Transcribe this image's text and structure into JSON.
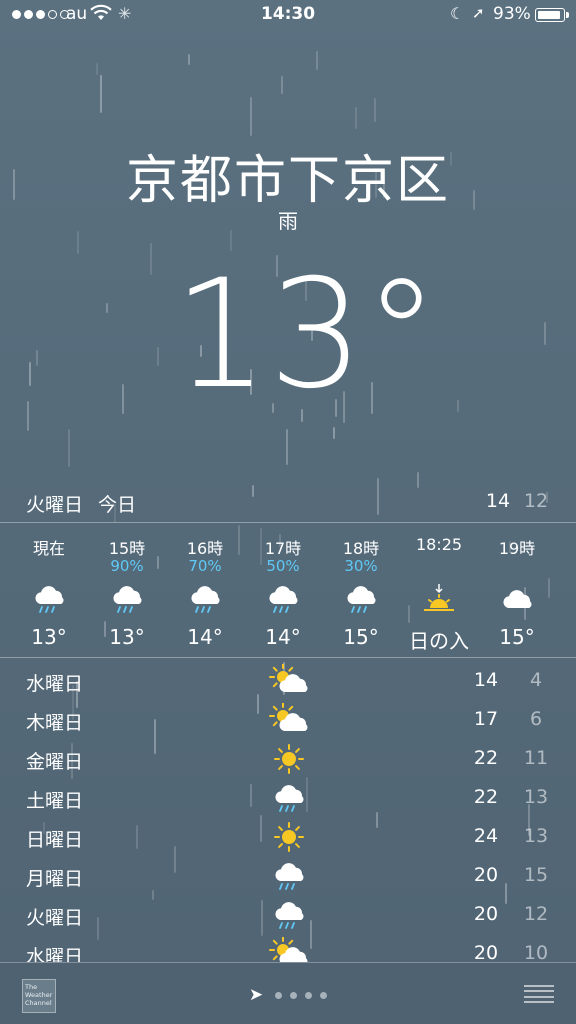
{
  "status": {
    "carrier": "au",
    "time": "14:30",
    "battery": "93%",
    "signal_bars": 3,
    "signal_total": 5,
    "battery_level": 0.93
  },
  "location": {
    "city": "京都市下京区",
    "condition": "雨",
    "temperature": "13°"
  },
  "today": {
    "day": "火曜日",
    "label": "今日",
    "high": "14",
    "low": "12"
  },
  "hourly": [
    {
      "time": "現在",
      "pop": "",
      "icon": "rain-cloud-icon",
      "temp": "13°"
    },
    {
      "time": "15時",
      "pop": "90%",
      "icon": "rain-cloud-icon",
      "temp": "13°"
    },
    {
      "time": "16時",
      "pop": "70%",
      "icon": "rain-cloud-icon",
      "temp": "14°"
    },
    {
      "time": "17時",
      "pop": "50%",
      "icon": "rain-cloud-icon",
      "temp": "14°"
    },
    {
      "time": "18時",
      "pop": "30%",
      "icon": "rain-cloud-icon",
      "temp": "15°"
    },
    {
      "time": "18:25",
      "pop": "",
      "icon": "sunset-icon",
      "temp": "日の入"
    },
    {
      "time": "19時",
      "pop": "",
      "icon": "cloud-icon",
      "temp": "15°"
    }
  ],
  "daily": [
    {
      "day": "水曜日",
      "icon": "partly-sunny-icon",
      "high": "14",
      "low": "4"
    },
    {
      "day": "木曜日",
      "icon": "partly-sunny-icon",
      "high": "17",
      "low": "6"
    },
    {
      "day": "金曜日",
      "icon": "sun-icon",
      "high": "22",
      "low": "11"
    },
    {
      "day": "土曜日",
      "icon": "rain-cloud-icon",
      "high": "22",
      "low": "13"
    },
    {
      "day": "日曜日",
      "icon": "sun-icon",
      "high": "24",
      "low": "13"
    },
    {
      "day": "月曜日",
      "icon": "rain-cloud-icon",
      "high": "20",
      "low": "15"
    },
    {
      "day": "火曜日",
      "icon": "rain-cloud-icon",
      "high": "20",
      "low": "12"
    },
    {
      "day": "水曜日",
      "icon": "partly-sunny-icon",
      "high": "20",
      "low": "10"
    }
  ],
  "footer": {
    "logo_text": "The Weather Channel",
    "page_count": 4
  },
  "colors": {
    "background": "#566b7a",
    "precip_blue": "#5fc8f5",
    "sun_yellow": "#f7c823"
  }
}
